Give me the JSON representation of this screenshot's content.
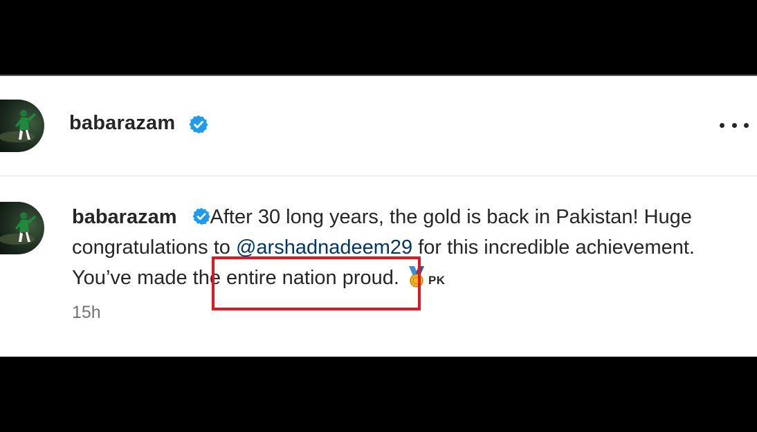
{
  "post": {
    "username": "babarazam",
    "verified": true,
    "caption": {
      "text_before_mention": "After 30 long years, the gold is back in Pakistan! Huge congratulations to ",
      "mention": "@arshadnadeem29",
      "text_after_mention": " for this incredible achievement. You’ve made the entire nation proud.",
      "emoji_icon": "sports-medal-icon",
      "flag_code": "PK"
    },
    "timestamp": "15h"
  },
  "annotation": {
    "highlight_color": "#e8141c",
    "highlighted_text": "After 30 long years,"
  },
  "colors": {
    "verified_badge": "#1d9bf0",
    "mention": "#00376b",
    "text": "#262626",
    "muted": "#737373"
  }
}
